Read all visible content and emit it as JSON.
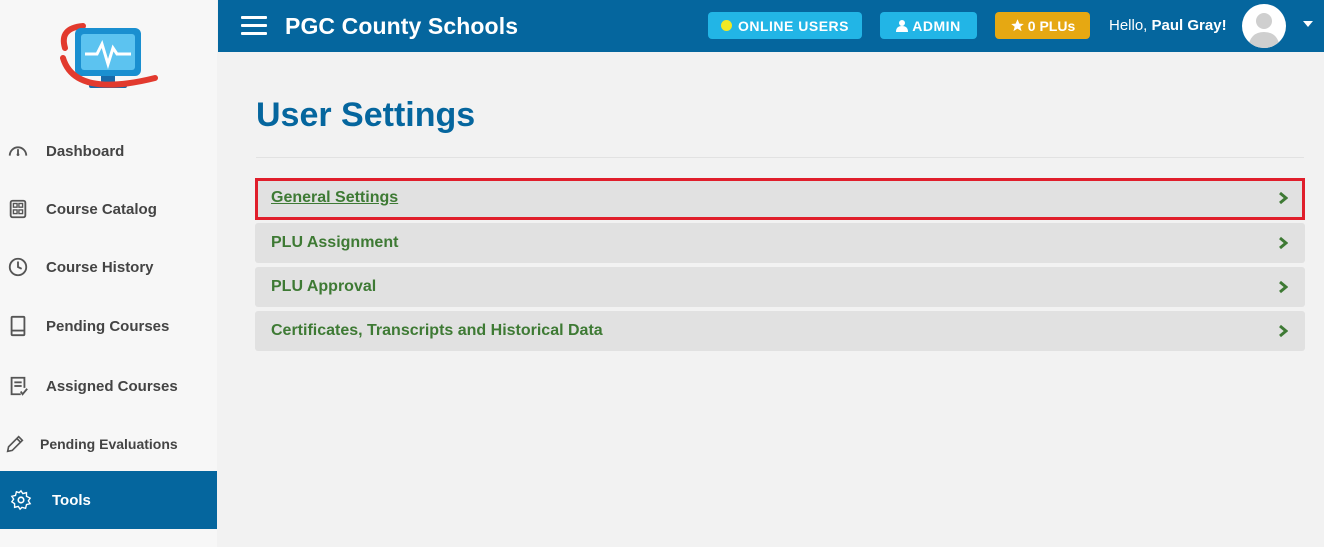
{
  "app": {
    "title": "PGC County Schools"
  },
  "header": {
    "online_users": "ONLINE USERS",
    "admin": "ADMIN",
    "plus": "0 PLUs",
    "greeting": "Hello, ",
    "user_name": "Paul Gray!"
  },
  "sidebar": {
    "items": [
      {
        "label": "Dashboard",
        "icon": "gauge-icon"
      },
      {
        "label": "Course Catalog",
        "icon": "catalog-icon"
      },
      {
        "label": "Course History",
        "icon": "clock-icon"
      },
      {
        "label": "Pending Courses",
        "icon": "book-icon"
      },
      {
        "label": "Assigned Courses",
        "icon": "checklist-icon"
      },
      {
        "label": "Pending Evaluations",
        "icon": "pencil-icon"
      },
      {
        "label": "Tools",
        "icon": "gear-icon",
        "active": true
      }
    ]
  },
  "main": {
    "title": "User Settings",
    "rows": [
      {
        "label": "General Settings",
        "highlighted": true
      },
      {
        "label": "PLU Assignment"
      },
      {
        "label": "PLU Approval"
      },
      {
        "label": "Certificates, Transcripts and Historical Data"
      }
    ]
  },
  "colors": {
    "primary": "#05669e",
    "pill_blue": "#22b5e6",
    "pill_gold": "#e6a812",
    "row_text": "#3e7a34",
    "highlight": "#e01e2b"
  }
}
